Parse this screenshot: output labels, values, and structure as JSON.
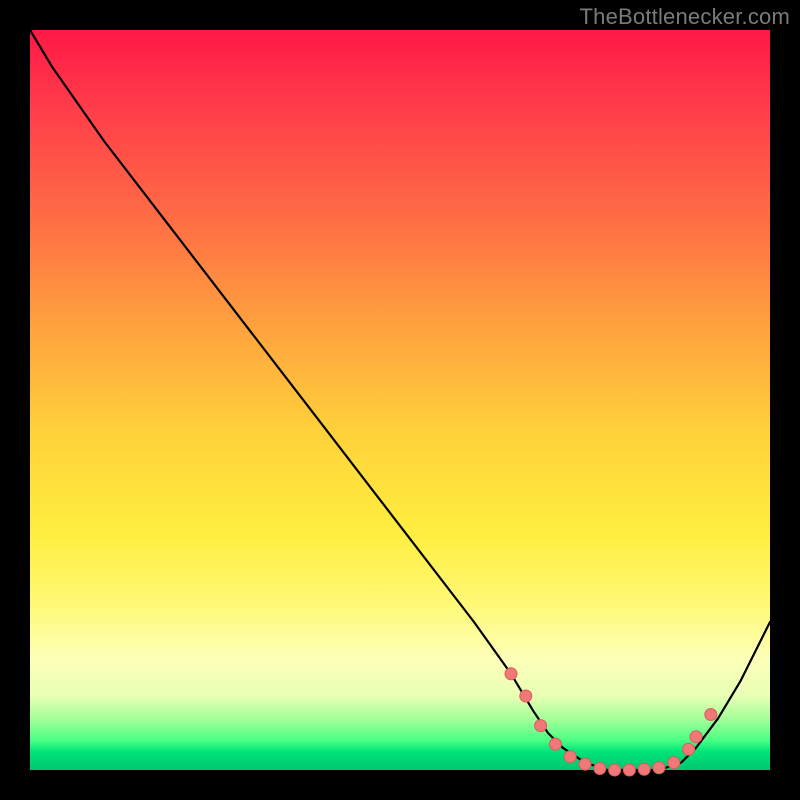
{
  "attribution": "TheBottlenecker.com",
  "colors": {
    "gradient_top": "#ff1846",
    "gradient_mid": "#ffee3f",
    "gradient_bottom": "#00c770",
    "line": "#000000",
    "dot_fill": "#f07878",
    "dot_stroke": "#e05a5a",
    "background": "#000000"
  },
  "chart_data": {
    "type": "line",
    "title": "",
    "xlabel": "",
    "ylabel": "",
    "xlim": [
      0,
      100
    ],
    "ylim": [
      0,
      100
    ],
    "x": [
      0,
      3,
      10,
      20,
      30,
      40,
      50,
      60,
      65,
      68,
      70,
      72,
      75,
      78,
      80,
      82,
      85,
      88,
      90,
      93,
      96,
      100
    ],
    "values": [
      100,
      95,
      85,
      72,
      59,
      46,
      33,
      20,
      13,
      8,
      5,
      3,
      1,
      0,
      0,
      0,
      0,
      1,
      3,
      7,
      12,
      20
    ],
    "markers_x": [
      65,
      67,
      69,
      71,
      73,
      75,
      77,
      79,
      81,
      83,
      85,
      87,
      89,
      90,
      92
    ],
    "markers_values": [
      13,
      10,
      6,
      3.5,
      1.8,
      0.8,
      0.2,
      0,
      0,
      0.1,
      0.3,
      1.0,
      2.8,
      4.5,
      7.5
    ],
    "annotations": []
  }
}
